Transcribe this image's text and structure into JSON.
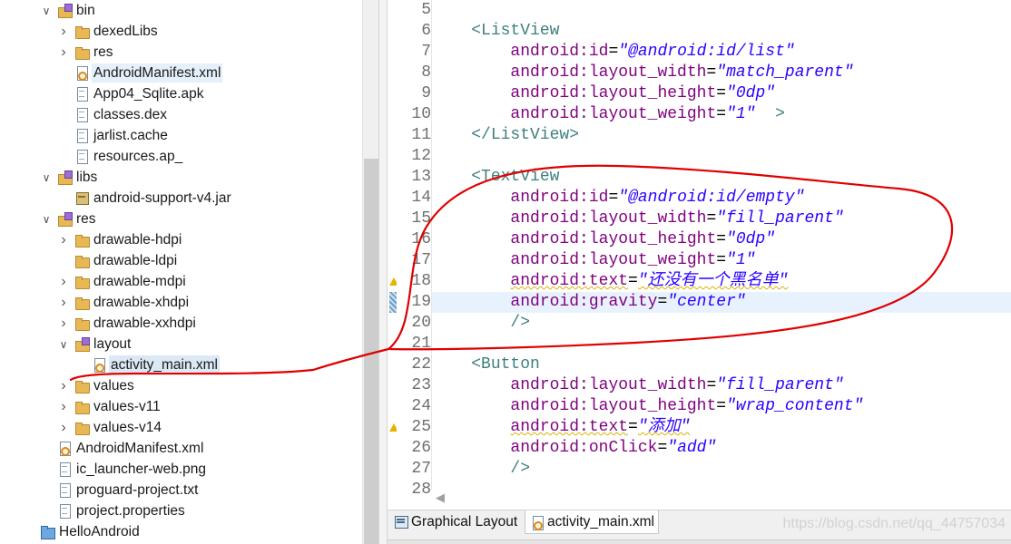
{
  "explorer": {
    "items": [
      {
        "label": "bin",
        "depth": 1,
        "arrow": "expanded",
        "icon": "package-folder-icon"
      },
      {
        "label": "dexedLibs",
        "depth": 2,
        "arrow": "collapsed",
        "icon": "folder-icon"
      },
      {
        "label": "res",
        "depth": 2,
        "arrow": "collapsed",
        "icon": "folder-icon"
      },
      {
        "label": "AndroidManifest.xml",
        "depth": 2,
        "arrow": "none",
        "icon": "xml-icon",
        "highlighted": true
      },
      {
        "label": "App04_Sqlite.apk",
        "depth": 2,
        "arrow": "none",
        "icon": "file-icon"
      },
      {
        "label": "classes.dex",
        "depth": 2,
        "arrow": "none",
        "icon": "file-icon"
      },
      {
        "label": "jarlist.cache",
        "depth": 2,
        "arrow": "none",
        "icon": "file-icon"
      },
      {
        "label": "resources.ap_",
        "depth": 2,
        "arrow": "none",
        "icon": "file-icon"
      },
      {
        "label": "libs",
        "depth": 1,
        "arrow": "expanded",
        "icon": "package-folder-icon"
      },
      {
        "label": "android-support-v4.jar",
        "depth": 2,
        "arrow": "none",
        "icon": "jar-icon"
      },
      {
        "label": "res",
        "depth": 1,
        "arrow": "expanded",
        "icon": "package-folder-icon"
      },
      {
        "label": "drawable-hdpi",
        "depth": 2,
        "arrow": "collapsed",
        "icon": "folder-icon"
      },
      {
        "label": "drawable-ldpi",
        "depth": 2,
        "arrow": "none",
        "icon": "folder-icon"
      },
      {
        "label": "drawable-mdpi",
        "depth": 2,
        "arrow": "collapsed",
        "icon": "folder-icon"
      },
      {
        "label": "drawable-xhdpi",
        "depth": 2,
        "arrow": "collapsed",
        "icon": "folder-icon"
      },
      {
        "label": "drawable-xxhdpi",
        "depth": 2,
        "arrow": "collapsed",
        "icon": "folder-icon"
      },
      {
        "label": "layout",
        "depth": 2,
        "arrow": "expanded",
        "icon": "package-folder-icon"
      },
      {
        "label": "activity_main.xml",
        "depth": 3,
        "arrow": "none",
        "icon": "xml-icon",
        "selected": true
      },
      {
        "label": "values",
        "depth": 2,
        "arrow": "collapsed",
        "icon": "folder-icon"
      },
      {
        "label": "values-v11",
        "depth": 2,
        "arrow": "collapsed",
        "icon": "folder-icon"
      },
      {
        "label": "values-v14",
        "depth": 2,
        "arrow": "collapsed",
        "icon": "folder-icon"
      },
      {
        "label": "AndroidManifest.xml",
        "depth": 1,
        "arrow": "none",
        "icon": "xml-icon"
      },
      {
        "label": "ic_launcher-web.png",
        "depth": 1,
        "arrow": "none",
        "icon": "file-icon"
      },
      {
        "label": "proguard-project.txt",
        "depth": 1,
        "arrow": "none",
        "icon": "file-icon"
      },
      {
        "label": "project.properties",
        "depth": 1,
        "arrow": "none",
        "icon": "file-icon"
      },
      {
        "label": "HelloAndroid",
        "depth": 0,
        "arrow": "none",
        "icon": "project-icon"
      }
    ]
  },
  "editor": {
    "lines": [
      {
        "n": "5",
        "parts": []
      },
      {
        "n": "6",
        "parts": [
          [
            "    ",
            ""
          ],
          [
            "<ListView",
            "tag"
          ]
        ]
      },
      {
        "n": "7",
        "parts": [
          [
            "        ",
            ""
          ],
          [
            "android:id",
            "attr"
          ],
          [
            "=",
            "eq"
          ],
          [
            "\"@android:id/list\"",
            "val"
          ]
        ]
      },
      {
        "n": "8",
        "parts": [
          [
            "        ",
            ""
          ],
          [
            "android:layout_width",
            "attr"
          ],
          [
            "=",
            "eq"
          ],
          [
            "\"match_parent\"",
            "val"
          ]
        ]
      },
      {
        "n": "9",
        "parts": [
          [
            "        ",
            ""
          ],
          [
            "android:layout_height",
            "attr"
          ],
          [
            "=",
            "eq"
          ],
          [
            "\"0dp\"",
            "val"
          ]
        ]
      },
      {
        "n": "10",
        "parts": [
          [
            "        ",
            ""
          ],
          [
            "android:layout_weight",
            "attr"
          ],
          [
            "=",
            "eq"
          ],
          [
            "\"1\"",
            "val"
          ],
          [
            "  >",
            "tag"
          ]
        ]
      },
      {
        "n": "11",
        "parts": [
          [
            "    ",
            ""
          ],
          [
            "</ListView>",
            "tag"
          ]
        ]
      },
      {
        "n": "12",
        "parts": []
      },
      {
        "n": "13",
        "parts": [
          [
            "    ",
            ""
          ],
          [
            "<TextView",
            "tag"
          ]
        ]
      },
      {
        "n": "14",
        "parts": [
          [
            "        ",
            ""
          ],
          [
            "android:id",
            "attr"
          ],
          [
            "=",
            "eq"
          ],
          [
            "\"@android:id/empty\"",
            "val"
          ]
        ]
      },
      {
        "n": "15",
        "parts": [
          [
            "        ",
            ""
          ],
          [
            "android:layout_width",
            "attr"
          ],
          [
            "=",
            "eq"
          ],
          [
            "\"fill_parent\"",
            "val"
          ]
        ]
      },
      {
        "n": "16",
        "parts": [
          [
            "        ",
            ""
          ],
          [
            "android:layout_height",
            "attr"
          ],
          [
            "=",
            "eq"
          ],
          [
            "\"0dp\"",
            "val"
          ]
        ]
      },
      {
        "n": "17",
        "parts": [
          [
            "        ",
            ""
          ],
          [
            "android:layout_weight",
            "attr"
          ],
          [
            "=",
            "eq"
          ],
          [
            "\"1\"",
            "val"
          ]
        ]
      },
      {
        "n": "18",
        "parts": [
          [
            "        ",
            ""
          ],
          [
            "android:text",
            "attr warn-underline"
          ],
          [
            "=",
            "eq"
          ],
          [
            "\"还没有一个黑名单\"",
            "val warn-underline"
          ]
        ],
        "marker": "warn"
      },
      {
        "n": "19",
        "parts": [
          [
            "        ",
            ""
          ],
          [
            "android:gravity",
            "attr"
          ],
          [
            "=",
            "eq"
          ],
          [
            "\"center\"",
            "val"
          ]
        ],
        "marker": "change",
        "current": true
      },
      {
        "n": "20",
        "parts": [
          [
            "        ",
            ""
          ],
          [
            "/>",
            "tag"
          ]
        ]
      },
      {
        "n": "21",
        "parts": []
      },
      {
        "n": "22",
        "parts": [
          [
            "    ",
            ""
          ],
          [
            "<Button",
            "tag"
          ]
        ]
      },
      {
        "n": "23",
        "parts": [
          [
            "        ",
            ""
          ],
          [
            "android:layout_width",
            "attr"
          ],
          [
            "=",
            "eq"
          ],
          [
            "\"fill_parent\"",
            "val"
          ]
        ]
      },
      {
        "n": "24",
        "parts": [
          [
            "        ",
            ""
          ],
          [
            "android:layout_height",
            "attr"
          ],
          [
            "=",
            "eq"
          ],
          [
            "\"wrap_content\"",
            "val"
          ]
        ]
      },
      {
        "n": "25",
        "parts": [
          [
            "        ",
            ""
          ],
          [
            "android:text",
            "attr warn-underline"
          ],
          [
            "=",
            "eq"
          ],
          [
            "\"添加\"",
            "val warn-underline"
          ]
        ],
        "marker": "warn"
      },
      {
        "n": "26",
        "parts": [
          [
            "        ",
            ""
          ],
          [
            "android:onClick",
            "attr"
          ],
          [
            "=",
            "eq"
          ],
          [
            "\"add\"",
            "val"
          ]
        ]
      },
      {
        "n": "27",
        "parts": [
          [
            "        ",
            ""
          ],
          [
            "/>",
            "tag"
          ]
        ]
      },
      {
        "n": "28",
        "parts": []
      }
    ]
  },
  "tabs": {
    "graphical_layout": "Graphical Layout",
    "activity_main": "activity_main.xml"
  },
  "watermark": "https://blog.csdn.net/qq_44757034",
  "colors": {
    "tag": "#3f7f7f",
    "attribute": "#7f007f",
    "value": "#2a00ff",
    "annotation": "#e00000",
    "current_line": "#e8f2fe"
  }
}
